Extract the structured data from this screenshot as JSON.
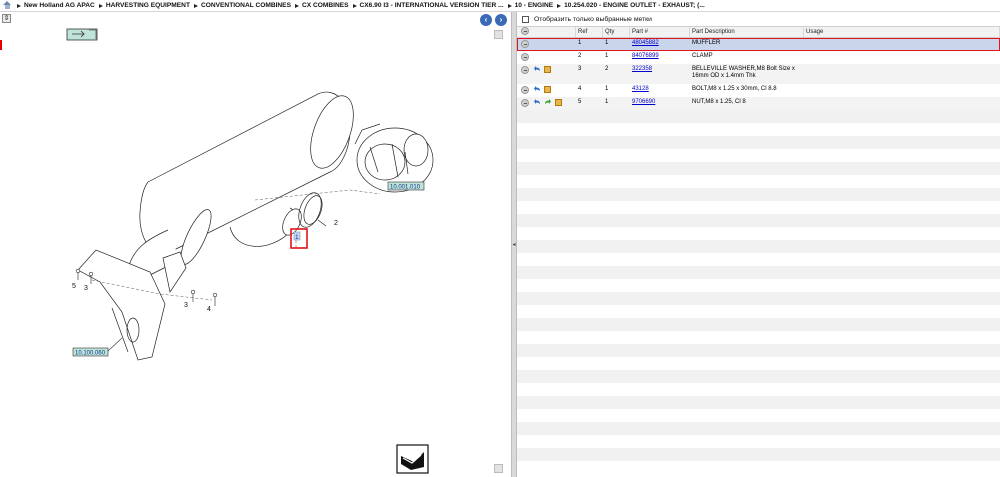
{
  "breadcrumb": [
    "New Holland AG APAC",
    "HARVESTING EQUIPMENT",
    "CONVENTIONAL COMBINES",
    "CX COMBINES",
    "CX6.90 I3 - INTERNATIONAL VERSION TIER ...",
    "10 - ENGINE",
    "10.254.020 - ENGINE OUTLET - EXHAUST; (..."
  ],
  "filter": {
    "label": "Отобразить только выбранные метки",
    "checked": false
  },
  "table": {
    "headers": {
      "ref": "Ref",
      "qty": "Qty",
      "part": "Part #",
      "desc": "Part Description",
      "usage": "Usage"
    },
    "rows": [
      {
        "ref": "1",
        "qty": "1",
        "part": "48045882",
        "desc": "MUFFLER",
        "usage": "",
        "selected": true,
        "icons": []
      },
      {
        "ref": "2",
        "qty": "1",
        "part": "84076899",
        "desc": "CLAMP",
        "usage": "",
        "selected": false,
        "icons": []
      },
      {
        "ref": "3",
        "qty": "2",
        "part": "322358",
        "desc": "BELLEVILLE WASHER,M8 Bolt Size x 16mm OD x 1.4mm Thk",
        "usage": "",
        "selected": false,
        "icons": [
          "back-arrow-icon",
          "box-icon"
        ]
      },
      {
        "ref": "4",
        "qty": "1",
        "part": "43128",
        "desc": "BOLT,M8 x 1.25 x 30mm, Cl 8.8",
        "usage": "",
        "selected": false,
        "icons": [
          "back-arrow-icon",
          "box-icon"
        ]
      },
      {
        "ref": "5",
        "qty": "1",
        "part": "9706690",
        "desc": "NUT,M8 x 1.25, Cl 8",
        "usage": "",
        "selected": false,
        "icons": [
          "back-arrow-icon",
          "green-arrow-icon",
          "box-icon"
        ]
      }
    ]
  },
  "drawing": {
    "callouts": [
      "1",
      "2",
      "3",
      "3",
      "4",
      "5"
    ],
    "ref_tags": [
      "10.001.010",
      "10.100.060"
    ]
  },
  "colors": {
    "selection": "#c9d5ea",
    "highlight": "#e0141c",
    "link": "#0000cc",
    "nav": "#3a69b6"
  }
}
